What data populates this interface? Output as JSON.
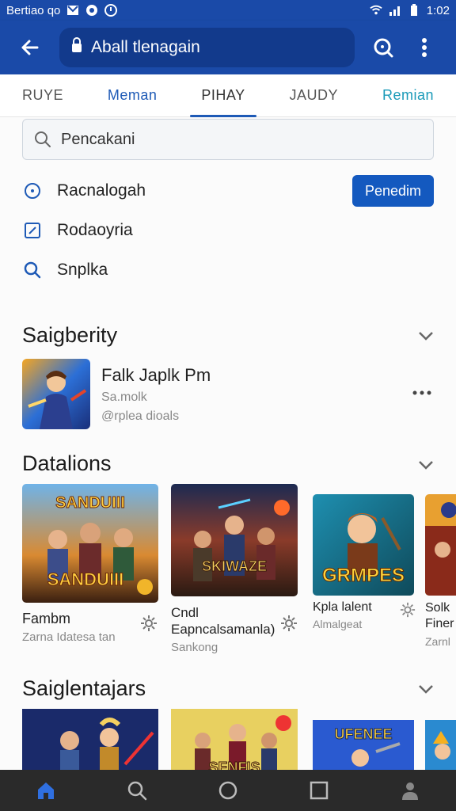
{
  "status_bar": {
    "left_text": "Bertiao qo",
    "time": "1:02"
  },
  "app_bar": {
    "url": "Aball tlenagain"
  },
  "tabs": [
    {
      "label": "RUYE"
    },
    {
      "label": "Meman"
    },
    {
      "label": "PIHAY"
    },
    {
      "label": "JAUDY"
    },
    {
      "label": "Remian"
    }
  ],
  "search": {
    "placeholder": "Pencakani"
  },
  "quick_items": [
    {
      "label": "Racnalogah",
      "icon": "target-icon"
    },
    {
      "label": "Rodaoyria",
      "icon": "edit-square-icon"
    },
    {
      "label": "Snplka",
      "icon": "search-icon"
    }
  ],
  "primary_button": {
    "label": "Penedim"
  },
  "section1": {
    "title": "Saigberity",
    "app": {
      "name": "Falk Japlk Pm",
      "sub1": "Sa.molk",
      "sub2": "@rplea dioals"
    }
  },
  "section2": {
    "title": "Datalions",
    "cards": [
      {
        "title": "Fambm",
        "sub": "Zarna Idatesa tan",
        "art": "SANDUIII"
      },
      {
        "title": "Cndl Eapncalsamanla)",
        "sub": "Sankong",
        "art": "SKIWAZE"
      },
      {
        "title": "Kpla lalent",
        "sub": "Almalgeat",
        "art": "GRMPES"
      },
      {
        "title": "Solk Finer",
        "sub": "Zarnl",
        "art": ""
      }
    ]
  },
  "section3": {
    "title": "Saiglentajars",
    "art_labels": [
      "",
      "SENFIS",
      "UFENEE"
    ]
  },
  "colors": {
    "primary": "#1a4aa8",
    "accent": "#1459bf",
    "nav_bg": "#2a2a2a"
  }
}
